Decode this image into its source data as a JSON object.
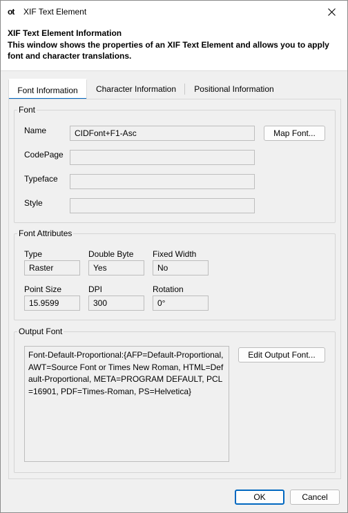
{
  "window": {
    "icon_text": "ot",
    "title": "XIF Text Element"
  },
  "header": {
    "title": "XIF Text Element Information",
    "description": "This window shows the properties of an XIF Text Element and allows you to apply font and character translations."
  },
  "tabs": [
    {
      "label": "Font Information",
      "active": true
    },
    {
      "label": "Character Information",
      "active": false
    },
    {
      "label": "Positional Information",
      "active": false
    }
  ],
  "font_group": {
    "label": "Font",
    "name_label": "Name",
    "name_value": "CIDFont+F1-Asc",
    "codepage_label": "CodePage",
    "codepage_value": "",
    "typeface_label": "Typeface",
    "typeface_value": "",
    "style_label": "Style",
    "style_value": "",
    "map_font_button": "Map Font..."
  },
  "attributes_group": {
    "label": "Font Attributes",
    "type_label": "Type",
    "type_value": "Raster",
    "double_byte_label": "Double Byte",
    "double_byte_value": "Yes",
    "fixed_width_label": "Fixed Width",
    "fixed_width_value": "No",
    "point_size_label": "Point Size",
    "point_size_value": "15.9599",
    "dpi_label": "DPI",
    "dpi_value": "300",
    "rotation_label": "Rotation",
    "rotation_value": "0°"
  },
  "output_group": {
    "label": "Output Font",
    "value": "Font-Default-Proportional:{AFP=Default-Proportional, AWT=Source Font or Times New Roman, HTML=Default-Proportional, META=PROGRAM DEFAULT, PCL=16901, PDF=Times-Roman, PS=Helvetica}",
    "edit_button": "Edit Output Font..."
  },
  "footer": {
    "ok_label": "OK",
    "cancel_label": "Cancel"
  },
  "colors": {
    "accent": "#0067c0",
    "background": "#f0f0f0"
  }
}
